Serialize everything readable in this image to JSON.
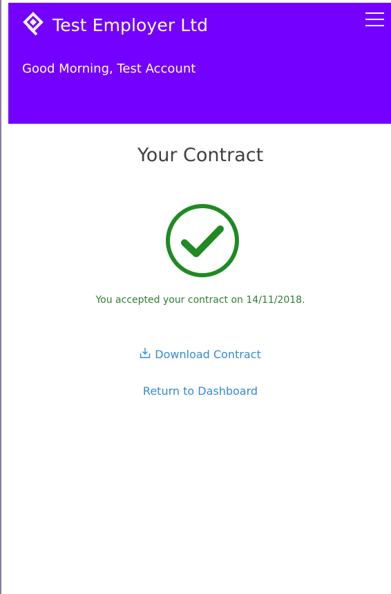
{
  "header": {
    "brand": "Test Employer Ltd",
    "greeting": "Good Morning, Test Account",
    "logo_icon": "diamond-logo-icon",
    "menu_icon": "hamburger-menu-icon",
    "background_color": "#7400ff"
  },
  "contract": {
    "title": "Your Contract",
    "status_icon": "check-circle-icon",
    "status_color": "#1f8a24",
    "accepted_message": "You accepted your contract on 14/11/2018.",
    "download_label": "Download Contract",
    "download_icon": "download-icon",
    "return_label": "Return to Dashboard",
    "link_color": "#3388dd"
  }
}
